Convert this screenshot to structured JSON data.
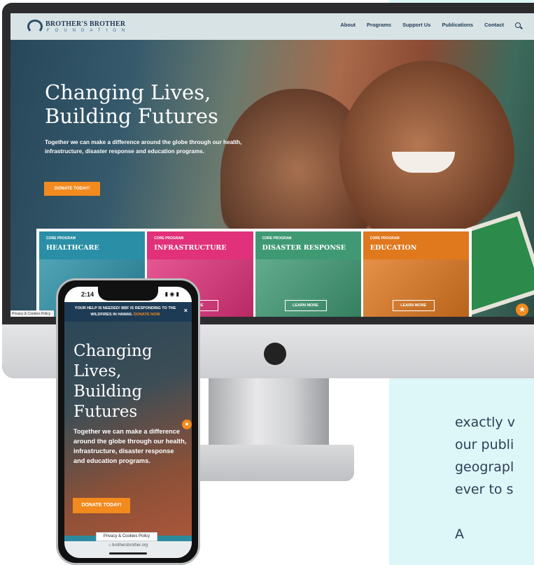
{
  "site": {
    "logo_name": "BROTHER'S BROTHER",
    "logo_sub": "FOUNDATION",
    "nav": [
      "About",
      "Programs",
      "Support Us",
      "Publications",
      "Contact"
    ],
    "hero_title": "Changing Lives, Building Futures",
    "hero_subtitle": "Together we can make a difference around the globe through our health, infrastructure, disaster response and education programs.",
    "donate_label": "DONATE TODAY!",
    "cards": [
      {
        "kicker": "CORE PROGRAM",
        "name": "HEALTHCARE",
        "color": "#2a8fa6",
        "learn": ""
      },
      {
        "kicker": "CORE PROGRAM",
        "name": "INFRASTRUCTURE",
        "color": "#e0317a",
        "learn": "MORE"
      },
      {
        "kicker": "CORE PROGRAM",
        "name": "DISASTER RESPONSE",
        "color": "#3f9a74",
        "learn": "LEARN MORE"
      },
      {
        "kicker": "CORE PROGRAM",
        "name": "EDUCATION",
        "color": "#e0781e",
        "learn": "LEARN MORE"
      }
    ],
    "privacy_tab": "Privacy & Cookies Policy"
  },
  "phone": {
    "time": "2:14",
    "status_icons": "▮ ◉ ▮",
    "alert_text": "YOUR HELP IS NEEDED! BBF IS RESPONDING TO THE WILDFIRES IN HAWAII.",
    "alert_link": "DONATE NOW",
    "close": "×",
    "title": "Changing Lives, Building Futures",
    "subtitle": "Together we can make a difference around the globe through our health, infrastructure, disaster response and education programs.",
    "donate_label": "DONATE TODAY!",
    "privacy": "Privacy & Cookies Policy",
    "url": "⌂ brothersbrother.org"
  },
  "side_text": [
    "exactly v",
    "our publi",
    "geograpl",
    "ever to s",
    "A"
  ],
  "colors": {
    "accent": "#f28a1e",
    "navy": "#1f3a52",
    "panel": "#ddf6f7"
  }
}
